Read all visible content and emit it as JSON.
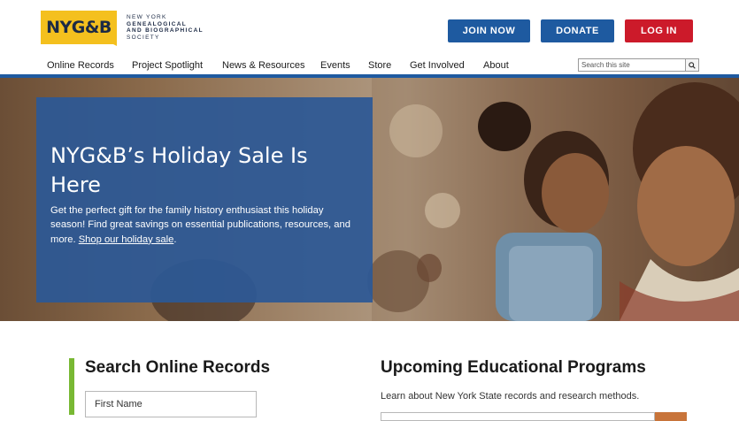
{
  "logo": {
    "text": "NYG&B",
    "society_lines": [
      "NEW YORK",
      "GENEALOGICAL",
      "AND BIOGRAPHICAL",
      "SOCIETY"
    ]
  },
  "header_buttons": {
    "join": "JOIN NOW",
    "donate": "DONATE",
    "login": "LOG IN"
  },
  "nav": {
    "items": [
      "Online Records",
      "Project Spotlight",
      "News & Resources",
      "Events",
      "Store",
      "Get Involved",
      "About"
    ]
  },
  "search": {
    "placeholder": "Search this site"
  },
  "hero": {
    "title": "NYG&B’s Holiday Sale Is Here",
    "body": "Get the perfect gift for the family history enthusiast this holiday season! Find great savings on essential publications, resources, and more.",
    "link": "Shop our holiday sale",
    "after_link": "."
  },
  "online_records": {
    "heading": "Search Online Records",
    "first_name_placeholder": "First Name"
  },
  "education": {
    "heading": "Upcoming Educational Programs",
    "subtext": "Learn about New York State records and research methods."
  },
  "colors": {
    "brand_yellow": "#f4c01e",
    "brand_blue": "#1e5aa0",
    "login_red": "#cc1a2a",
    "accent_green": "#78b833"
  }
}
